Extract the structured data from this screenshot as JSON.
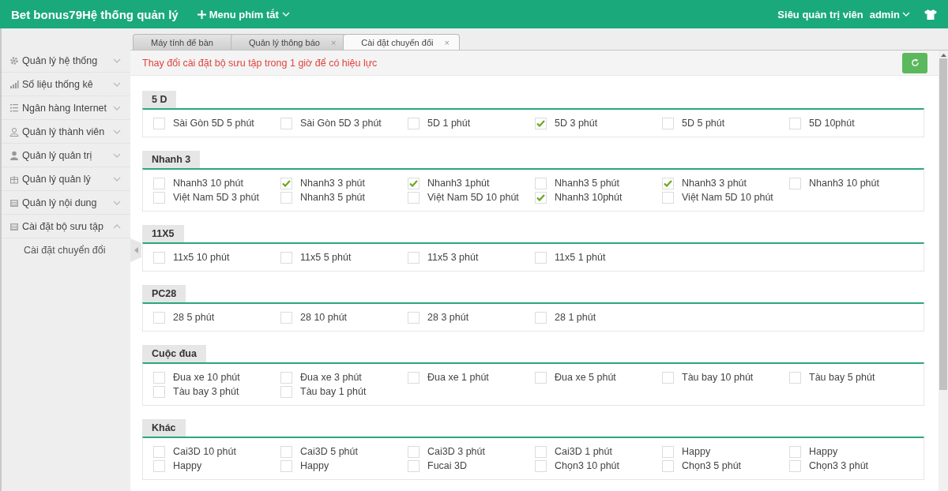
{
  "header": {
    "title": "Bet bonus79Hệ thống quản lý",
    "shortcut_menu": "Menu phím tắt",
    "role": "Siêu quản trị viên",
    "user": "admin"
  },
  "sidebar": {
    "items": [
      {
        "label": "Quản lý hệ thống",
        "expanded": false
      },
      {
        "label": "Số liệu thống kê",
        "expanded": false
      },
      {
        "label": "Ngân hàng Internet",
        "expanded": false
      },
      {
        "label": "Quản lý thành viên",
        "expanded": false
      },
      {
        "label": "Quản lý quản trị",
        "expanded": false
      },
      {
        "label": "Quản lý quản lý",
        "expanded": false
      },
      {
        "label": "Quản lý nội dung",
        "expanded": false
      },
      {
        "label": "Cài đặt bộ sưu tập",
        "expanded": true,
        "children": [
          {
            "label": "Cài đặt chuyển đổi"
          }
        ]
      }
    ]
  },
  "tabs": [
    {
      "label": "Máy tính để bàn",
      "selected": false
    },
    {
      "label": "Quản lý thông báo",
      "selected": false,
      "close": "×"
    },
    {
      "label": "Cài đặt chuyển đổi",
      "selected": true,
      "close": "×"
    }
  ],
  "notice": "Thay đổi cài đặt bộ sưu tập trong 1 giờ để có hiệu lực",
  "groups": [
    {
      "title": "5 D",
      "options": [
        {
          "label": "Sài Gòn 5D 5 phút",
          "checked": false
        },
        {
          "label": "Sài Gòn 5D 3 phút",
          "checked": false
        },
        {
          "label": "5D 1 phút",
          "checked": false
        },
        {
          "label": "5D 3 phút",
          "checked": true
        },
        {
          "label": "5D 5 phút",
          "checked": false
        },
        {
          "label": "5D 10phút",
          "checked": false
        }
      ]
    },
    {
      "title": "Nhanh 3",
      "options": [
        {
          "label": "Nhanh3 10 phút",
          "checked": false
        },
        {
          "label": "Nhanh3 3 phút",
          "checked": true
        },
        {
          "label": "Nhanh3 1phút",
          "checked": true
        },
        {
          "label": "Nhanh3 5 phút",
          "checked": false
        },
        {
          "label": "Nhanh3 3 phút",
          "checked": true
        },
        {
          "label": "Nhanh3 10 phút",
          "checked": false
        },
        {
          "label": "Việt Nam 5D 3 phút",
          "checked": false
        },
        {
          "label": "Nhanh3 5 phút",
          "checked": false
        },
        {
          "label": "Việt Nam 5D 10 phút",
          "checked": false
        },
        {
          "label": "Nhanh3 10phút",
          "checked": true
        },
        {
          "label": "Việt Nam 5D 10 phút",
          "checked": false
        }
      ]
    },
    {
      "title": "11X5",
      "options": [
        {
          "label": "11x5 10 phút",
          "checked": false
        },
        {
          "label": "11x5 5 phút",
          "checked": false
        },
        {
          "label": "11x5 3 phút",
          "checked": false
        },
        {
          "label": "11x5 1 phút",
          "checked": false
        }
      ]
    },
    {
      "title": "PC28",
      "options": [
        {
          "label": "28 5 phút",
          "checked": false
        },
        {
          "label": "28 10 phút",
          "checked": false
        },
        {
          "label": "28 3 phút",
          "checked": false
        },
        {
          "label": "28 1 phút",
          "checked": false
        }
      ]
    },
    {
      "title": "Cuộc đua",
      "options": [
        {
          "label": "Đua xe 10 phút",
          "checked": false
        },
        {
          "label": "Đua xe 3 phút",
          "checked": false
        },
        {
          "label": "Đua xe 1 phút",
          "checked": false
        },
        {
          "label": "Đua xe 5 phút",
          "checked": false
        },
        {
          "label": "Tàu bay 10 phút",
          "checked": false
        },
        {
          "label": "Tàu bay 5 phút",
          "checked": false
        },
        {
          "label": "Tàu bay 3 phút",
          "checked": false
        },
        {
          "label": "Tàu bay 1 phút",
          "checked": false
        }
      ]
    },
    {
      "title": "Khác",
      "options": [
        {
          "label": "Cai3D 10 phút",
          "checked": false
        },
        {
          "label": "Cai3D 5 phút",
          "checked": false
        },
        {
          "label": "Cai3D 3 phút",
          "checked": false
        },
        {
          "label": "Cai3D 1 phút",
          "checked": false
        },
        {
          "label": "Happy",
          "checked": false
        },
        {
          "label": "Happy",
          "checked": false
        },
        {
          "label": "Happy",
          "checked": false
        },
        {
          "label": "Happy",
          "checked": false
        },
        {
          "label": "Fucai 3D",
          "checked": false
        },
        {
          "label": "Chọn3 10 phút",
          "checked": false
        },
        {
          "label": "Chọn3 5 phút",
          "checked": false
        },
        {
          "label": "Chọn3 3 phút",
          "checked": false
        }
      ]
    }
  ]
}
